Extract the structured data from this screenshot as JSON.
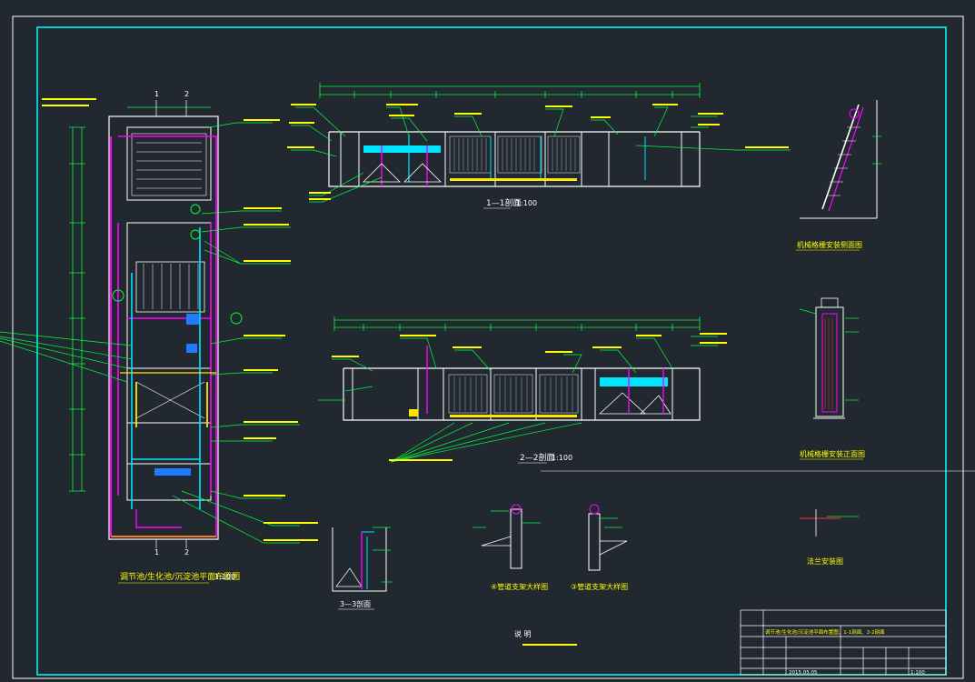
{
  "colors": {
    "background": "#212830",
    "frame": "#ffffff",
    "inner_frame": "#00ffff",
    "dimension": "#00ff3a",
    "leader": "#00ff3a",
    "outline": "#ffffff",
    "pipe_magenta": "#ff00ff",
    "pipe_cyan": "#00e5ff",
    "pipe_blue": "#1f7bff",
    "pipe_orange": "#ff7a1a",
    "label_yellow": "#ffff00",
    "fill_yellow": "#ffe600"
  },
  "labels": {
    "plan_title": "调节池/生化池/沉淀池平面布置图",
    "plan_scale": "1:100",
    "section_1_title": "1—1剖面",
    "section_1_scale": "1:100",
    "section_2_title": "2—2剖面",
    "section_2_scale": "1:100",
    "section_3_title": "3—3剖面",
    "grille_side_title": "机械格栅安装侧面图",
    "grille_front_title": "机械格栅安装正面图",
    "detail_4_title": "④管道支架大样图",
    "detail_3_title": "③管道支架大样图",
    "flange_title": "法兰安装图",
    "notes_title": "说  明",
    "cut_1": "1",
    "cut_2": "2",
    "elev_1": "-2.50",
    "elev_2": "-0.30",
    "elev_3": "-4.00",
    "elev_4": "-1.20",
    "elev_5": "-3.50",
    "elev_6": "0.00"
  },
  "title_block": {
    "drawing_name": "调节池/生化池/沉淀池平面布置图、1-1剖面、2-2剖面",
    "date": "2015.05.05",
    "scale": "1:100"
  }
}
